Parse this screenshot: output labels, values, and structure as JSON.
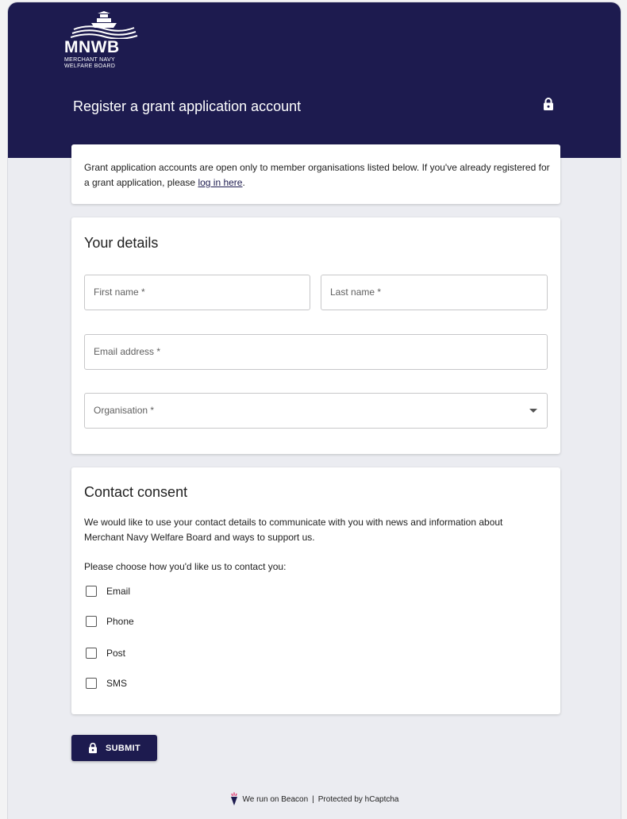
{
  "logo": {
    "acronym": "MNWB",
    "line1": "MERCHANT NAVY",
    "line2": "WELFARE BOARD",
    "icon": "ship-waves-logo"
  },
  "header": {
    "title": "Register a grant application account",
    "icon": "lock-icon"
  },
  "info": {
    "text_before": "Grant application accounts are open only to member organisations listed below. If you've already registered for a grant application, please ",
    "link_text": "log in here",
    "text_after": "."
  },
  "details": {
    "title": "Your details",
    "first_name_label": "First name *",
    "last_name_label": "Last name *",
    "email_label": "Email address *",
    "organisation_label": "Organisation *"
  },
  "consent": {
    "title": "Contact consent",
    "description": "We would like to use your contact details to communicate with you with news and information about Merchant Navy Welfare Board and ways to support us.",
    "prompt": "Please choose how you'd like us to contact you:",
    "options": [
      {
        "label": "Email",
        "checked": false
      },
      {
        "label": "Phone",
        "checked": false
      },
      {
        "label": "Post",
        "checked": false
      },
      {
        "label": "SMS",
        "checked": false
      }
    ]
  },
  "submit": {
    "label": "SUBMIT",
    "icon": "lock-icon"
  },
  "footer": {
    "beacon_text": "We run on Beacon",
    "separator": "|",
    "captcha_text": "Protected by hCaptcha",
    "icon": "torch-icon"
  },
  "colors": {
    "brand_navy": "#1d1b4f",
    "background": "#ebecf1",
    "card": "#ffffff"
  }
}
